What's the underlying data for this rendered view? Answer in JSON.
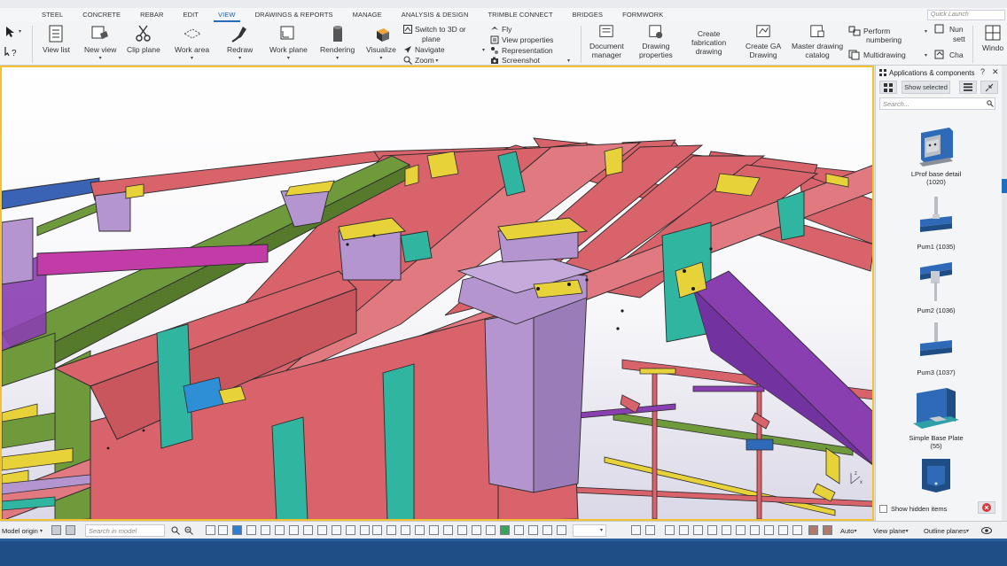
{
  "menu": {
    "tabs": [
      "STEEL",
      "CONCRETE",
      "REBAR",
      "EDIT",
      "VIEW",
      "DRAWINGS & REPORTS",
      "MANAGE",
      "ANALYSIS & DESIGN",
      "TRIMBLE CONNECT",
      "BRIDGES",
      "FORMWORK"
    ],
    "active_tab": "VIEW",
    "quick_launch_placeholder": "Quick Launch"
  },
  "ribbon": {
    "view_list": "View list",
    "new_view": "New view",
    "clip_plane": "Clip plane",
    "work_area": "Work area",
    "redraw": "Redraw",
    "work_plane": "Work plane",
    "rendering": "Rendering",
    "visualize": "Visualize",
    "switch_3d_line1": "Switch to 3D or",
    "switch_3d_line2": "plane",
    "navigate": "Navigate",
    "zoom": "Zoom",
    "fly": "Fly",
    "view_properties": "View properties",
    "representation": "Representation",
    "screenshot": "Screenshot",
    "document_manager_1": "Document",
    "document_manager_2": "manager",
    "drawing_properties_1": "Drawing",
    "drawing_properties_2": "properties",
    "create_fab_1": "Create",
    "create_fab_2": "fabrication",
    "create_fab_3": "drawing",
    "create_ga_1": "Create GA",
    "create_ga_2": "Drawing",
    "master_cat_1": "Master drawing",
    "master_cat_2": "catalog",
    "perform_num_1": "Perform",
    "perform_num_2": "numbering",
    "multidrawing": "Multidrawing",
    "num_sett_1": "Nun",
    "num_sett_2": "sett",
    "cha": "Cha",
    "window": "Windo"
  },
  "panel": {
    "title": "Applications & components",
    "show_selected": "Show selected",
    "search_placeholder": "Search...",
    "items": [
      {
        "name": "LProf base detail",
        "code": "(1020)"
      },
      {
        "name": "Pum1 (1035)",
        "code": ""
      },
      {
        "name": "Pum2 (1036)",
        "code": ""
      },
      {
        "name": "Pum3 (1037)",
        "code": ""
      },
      {
        "name": "Simple Base Plate",
        "code": "(55)"
      }
    ],
    "show_hidden": "Show hidden items"
  },
  "bottombar": {
    "model_origin": "Model origin",
    "search_placeholder": "Search in model",
    "auto": "Auto",
    "view_plane": "View plane",
    "outline_planes": "Outline planes"
  },
  "colors": {
    "accent": "#2a6ab8",
    "viewport_border": "#f2c232",
    "status_bar": "#1f4e86",
    "beam_red": "#d9636b",
    "beam_green": "#6f9a3c",
    "beam_teal": "#2fb5a0",
    "beam_purple": "#8a3fb0",
    "plate_yellow": "#e8d23a",
    "plate_lilac": "#b495cf"
  }
}
